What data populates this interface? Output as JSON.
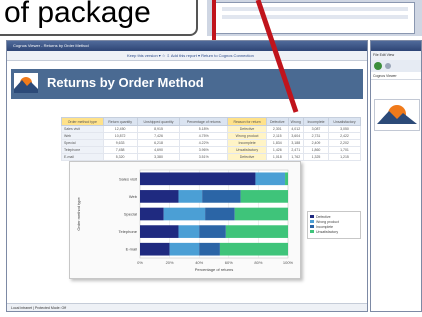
{
  "callout": {
    "text": "of package"
  },
  "report_window": {
    "title": "Cognos Viewer - Returns by Order Method",
    "toolbar": "Keep this version  ▾  ☆  ⇩  Add this report  ▾  Return to Cognos Connection"
  },
  "banner": {
    "title": "Returns by Order Method"
  },
  "table": {
    "columns": [
      "Order method type",
      "Return quantity",
      "Unshipped quantity",
      "Percentage of returns",
      "Reason for return",
      "Defective",
      "Wrong",
      "Incomplete",
      "Unsatisfactory"
    ],
    "highlight_columns": [
      0,
      4
    ],
    "rows": [
      [
        "Sales visit",
        "12,450",
        "8,915",
        "5.18%",
        "Defective",
        "2,301",
        "4,012",
        "3,087",
        "3,050"
      ],
      [
        "Web",
        "10,872",
        "7,426",
        "4.75%",
        "Wrong product",
        "2,115",
        "3,604",
        "2,731",
        "2,422"
      ],
      [
        "Special",
        "9,633",
        "6,218",
        "4.22%",
        "Incomplete",
        "1,834",
        "3,188",
        "2,409",
        "2,202"
      ],
      [
        "Telephone",
        "7,458",
        "4,690",
        "3.96%",
        "Unsatisfactory",
        "1,426",
        "2,471",
        "1,860",
        "1,701"
      ],
      [
        "E-mail",
        "5,320",
        "3,380",
        "3.51%",
        "Defective",
        "1,018",
        "1,762",
        "1,325",
        "1,215"
      ]
    ]
  },
  "chart_data": {
    "type": "bar",
    "orientation": "horizontal",
    "stacked": true,
    "categories": [
      "Sales visit",
      "Web",
      "Special",
      "Telephone",
      "E-mail"
    ],
    "series": [
      {
        "name": "Defective",
        "color": "#1f2a80",
        "values": [
          78,
          26,
          16,
          26,
          20
        ]
      },
      {
        "name": "Wrong product",
        "color": "#4b9fd5",
        "values": [
          20,
          16,
          28,
          14,
          20
        ]
      },
      {
        "name": "Incomplete",
        "color": "#2b65a6",
        "values": [
          0,
          26,
          20,
          18,
          14
        ]
      },
      {
        "name": "Unsatisfactory",
        "color": "#3fc47a",
        "values": [
          2,
          32,
          36,
          42,
          46
        ]
      }
    ],
    "xlim": [
      0,
      100
    ],
    "xticks": [
      "0%",
      "20%",
      "40%",
      "60%",
      "80%",
      "100%"
    ],
    "xlabel": "Percentage of returns",
    "ylabel": "Order method type",
    "legend": "right"
  },
  "status": {
    "text": "Local intranet | Protected Mode: Off"
  },
  "side_window": {
    "menu": "File  Edit  View",
    "address": "Cognos Viewer"
  },
  "colors": {
    "banner": "#4a6a92",
    "callout_arrow": "#c0141c",
    "table_highlight": "#ffe28a"
  }
}
